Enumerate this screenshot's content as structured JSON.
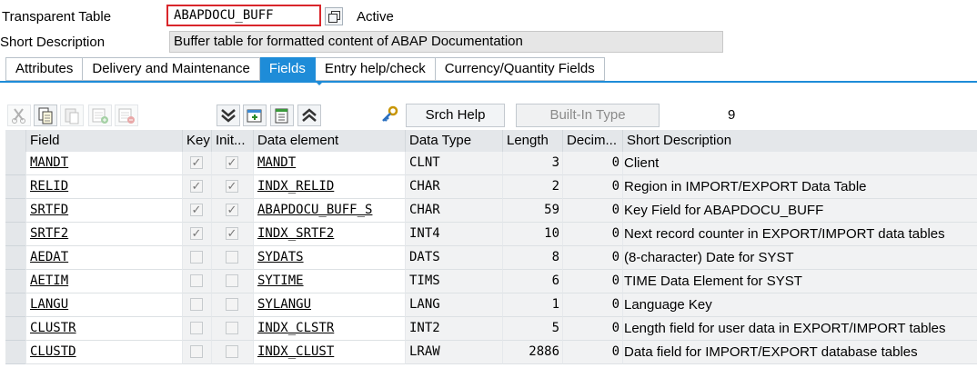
{
  "header": {
    "table_label": "Transparent Table",
    "table_name": "ABAPDOCU_BUFF",
    "status": "Active",
    "short_desc_label": "Short Description",
    "short_desc_value": "Buffer table for formatted content of ABAP Documentation"
  },
  "tabs": [
    {
      "label": "Attributes",
      "active": false
    },
    {
      "label": "Delivery and Maintenance",
      "active": false
    },
    {
      "label": "Fields",
      "active": true
    },
    {
      "label": "Entry help/check",
      "active": false
    },
    {
      "label": "Currency/Quantity Fields",
      "active": false
    }
  ],
  "toolbar": {
    "icons": [
      "cut-icon",
      "copy-icon",
      "paste-icon",
      "insert-row-icon",
      "delete-row-icon",
      "expand-all-icon",
      "new-field-icon",
      "details-icon",
      "collapse-all-icon",
      "key-icon"
    ],
    "srch_help_label": "Srch Help",
    "builtin_type_label": "Built-In Type",
    "field_count": "9"
  },
  "columns": [
    "Field",
    "Key",
    "Init...",
    "Data element",
    "Data Type",
    "Length",
    "Decim...",
    "Short Description"
  ],
  "rows": [
    {
      "field": "MANDT",
      "key": true,
      "init": true,
      "data_element": "MANDT",
      "data_type": "CLNT",
      "length": "3",
      "decimals": "0",
      "description": "Client"
    },
    {
      "field": "RELID",
      "key": true,
      "init": true,
      "data_element": "INDX_RELID",
      "data_type": "CHAR",
      "length": "2",
      "decimals": "0",
      "description": "Region in IMPORT/EXPORT Data Table"
    },
    {
      "field": "SRTFD",
      "key": true,
      "init": true,
      "data_element": "ABAPDOCU_BUFF_S",
      "data_type": "CHAR",
      "length": "59",
      "decimals": "0",
      "description": "Key Field for ABAPDOCU_BUFF"
    },
    {
      "field": "SRTF2",
      "key": true,
      "init": true,
      "data_element": "INDX_SRTF2",
      "data_type": "INT4",
      "length": "10",
      "decimals": "0",
      "description": "Next record counter in EXPORT/IMPORT data tables"
    },
    {
      "field": "AEDAT",
      "key": false,
      "init": false,
      "data_element": "SYDATS",
      "data_type": "DATS",
      "length": "8",
      "decimals": "0",
      "description": "(8-character) Date for SYST"
    },
    {
      "field": "AETIM",
      "key": false,
      "init": false,
      "data_element": "SYTIME",
      "data_type": "TIMS",
      "length": "6",
      "decimals": "0",
      "description": "TIME Data Element for SYST"
    },
    {
      "field": "LANGU",
      "key": false,
      "init": false,
      "data_element": "SYLANGU",
      "data_type": "LANG",
      "length": "1",
      "decimals": "0",
      "description": "Language Key"
    },
    {
      "field": "CLUSTR",
      "key": false,
      "init": false,
      "data_element": "INDX_CLSTR",
      "data_type": "INT2",
      "length": "5",
      "decimals": "0",
      "description": "Length field for user data in EXPORT/IMPORT tables"
    },
    {
      "field": "CLUSTD",
      "key": false,
      "init": false,
      "data_element": "INDX_CLUST",
      "data_type": "LRAW",
      "length": "2886",
      "decimals": "0",
      "description": "Data field for IMPORT/EXPORT database tables"
    }
  ],
  "colors": {
    "accent": "#1e8cd8",
    "highlight_border": "#d9262b",
    "header_bg": "#e4e7ea"
  }
}
